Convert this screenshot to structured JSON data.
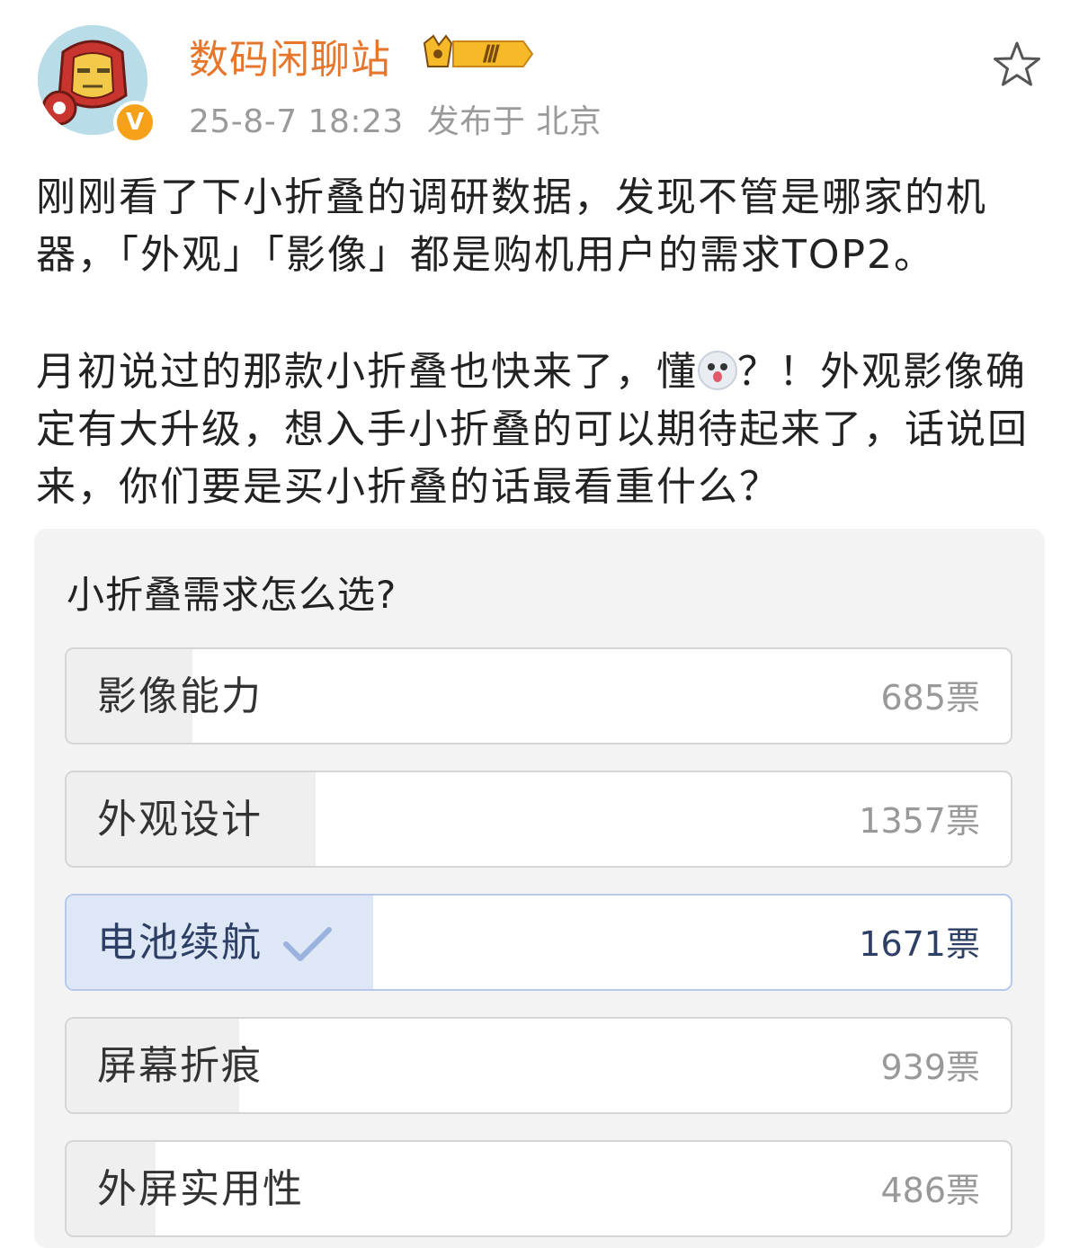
{
  "user": {
    "name": "数码闲聊站",
    "level_badge": "Ⅲ",
    "verified_mark": "V",
    "timestamp": "25-8-7 18:23",
    "location": "发布于 北京"
  },
  "post": {
    "paragraph1": "刚刚看了下小折叠的调研数据，发现不管是哪家的机器，「外观」「影像」都是购机用户的需求TOP2。",
    "paragraph2_before_emoji": "月初说过的那款小折叠也快来了，懂",
    "paragraph2_after_emoji": "？！外观影像确定有大升级，想入手小折叠的可以期待起来了，话说回来，你们要是买小折叠的话最看重什么？"
  },
  "poll": {
    "title": "小折叠需求怎么选?",
    "options": [
      {
        "label": "影像能力",
        "votes": 685,
        "votes_text": "685票",
        "selected": false
      },
      {
        "label": "外观设计",
        "votes": 1357,
        "votes_text": "1357票",
        "selected": false
      },
      {
        "label": "电池续航",
        "votes": 1671,
        "votes_text": "1671票",
        "selected": true
      },
      {
        "label": "屏幕折痕",
        "votes": 939,
        "votes_text": "939票",
        "selected": false
      },
      {
        "label": "外屏实用性",
        "votes": 486,
        "votes_text": "486票",
        "selected": false
      }
    ]
  },
  "colors": {
    "username": "#e5762b",
    "meta": "#9a9a9a",
    "selected_fill": "#dde7f6",
    "selected_text": "#2e3f66",
    "check": "#9ab2dc"
  },
  "icons": {
    "favorite": "star-outline-icon",
    "verified": "verified-v-icon",
    "crown": "crown-level-icon",
    "check": "check-icon",
    "emoji": "dog-emoji-icon"
  }
}
